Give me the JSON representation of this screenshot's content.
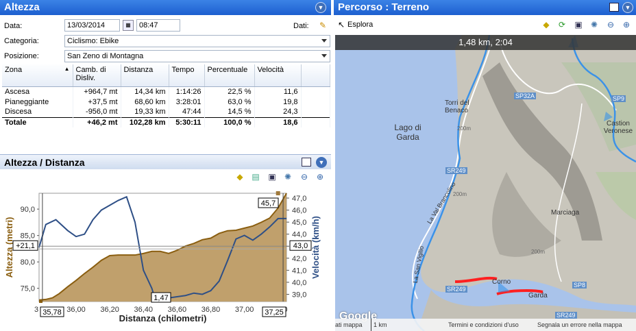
{
  "left_panel": {
    "title": "Altezza"
  },
  "form": {
    "date_label": "Data:",
    "date_value": "13/03/2014",
    "time_value": "08:47",
    "dati_label": "Dati:",
    "category_label": "Categoria:",
    "category_value": "Ciclismo: Ebike",
    "position_label": "Posizione:",
    "position_value": "San Zeno di Montagna"
  },
  "table": {
    "headers": [
      "Zona",
      "Camb. di Disliv.",
      "Distanza",
      "Tempo",
      "Percentuale",
      "Velocità"
    ],
    "rows": [
      [
        "Ascesa",
        "+964,7 mt",
        "14,34 km",
        "1:14:26",
        "22,5 %",
        "11,6"
      ],
      [
        "Pianeggiante",
        "+37,5 mt",
        "68,60 km",
        "3:28:01",
        "63,0 %",
        "19,8"
      ],
      [
        "Discesa",
        "-956,0 mt",
        "19,33 km",
        "47:44",
        "14,5 %",
        "24,3"
      ],
      [
        "Totale",
        "+46,2 mt",
        "102,28 km",
        "5:30:11",
        "100,0 %",
        "18,6"
      ]
    ]
  },
  "chart_section": {
    "title": "Altezza / Distanza"
  },
  "chart_data": {
    "type": "area",
    "xlabel": "Distanza (chilometri)",
    "ylabel": "Altezza (metri)",
    "y2label": "Velocità (km/h)",
    "xticks": [
      "3",
      "36,00",
      "36,20",
      "36,40",
      "36,60",
      "36,80",
      "37,00",
      "37,20"
    ],
    "yticks": [
      "75,0",
      "80,0",
      "85,0",
      "90,0"
    ],
    "y2ticks": [
      "39,0",
      "40,0",
      "41,0",
      "42,0",
      "43,0",
      "44,0",
      "45,0",
      "46,0",
      "47,0"
    ],
    "xlim": [
      35.78,
      37.25
    ],
    "ylim": [
      72.5,
      93
    ],
    "y2lim": [
      38.4,
      47.4
    ],
    "series": [
      {
        "name": "Altezza (metri)",
        "color": "#a07a3c",
        "x": [
          35.78,
          35.82,
          35.86,
          35.9,
          35.95,
          36.0,
          36.05,
          36.1,
          36.15,
          36.2,
          36.25,
          36.3,
          36.35,
          36.4,
          36.45,
          36.5,
          36.55,
          36.6,
          36.65,
          36.7,
          36.75,
          36.8,
          36.85,
          36.9,
          36.95,
          37.0,
          37.05,
          37.1,
          37.15,
          37.2,
          37.25
        ],
        "values": [
          72.8,
          72.9,
          73.2,
          74.0,
          75.3,
          76.5,
          77.8,
          79.0,
          80.3,
          81.2,
          81.3,
          81.3,
          81.3,
          81.6,
          82.0,
          82.0,
          81.6,
          82.2,
          83.0,
          83.5,
          84.2,
          84.5,
          85.4,
          85.9,
          86.0,
          86.4,
          86.8,
          87.5,
          88.3,
          90.2,
          93.0
        ]
      },
      {
        "name": "Velocità (km/h)",
        "color": "#2e4f86",
        "x": [
          35.78,
          35.82,
          35.88,
          35.95,
          36.0,
          36.05,
          36.1,
          36.15,
          36.25,
          36.3,
          36.35,
          36.4,
          36.45,
          36.47,
          36.5,
          36.55,
          36.6,
          36.65,
          36.7,
          36.75,
          36.8,
          36.85,
          36.9,
          36.95,
          37.0,
          37.05,
          37.1,
          37.15,
          37.2,
          37.25
        ],
        "values": [
          42.9,
          44.8,
          45.2,
          44.3,
          43.8,
          44.0,
          45.2,
          46.0,
          46.8,
          47.1,
          45.0,
          41.0,
          39.5,
          38.6,
          38.6,
          38.7,
          38.8,
          38.9,
          39.1,
          39.0,
          39.3,
          40.1,
          41.8,
          43.6,
          43.9,
          43.5,
          44.0,
          44.6,
          45.3,
          45.3
        ]
      }
    ],
    "labels": {
      "y_left_marker": "+21,1",
      "y_right_marker": "43,0",
      "max_marker": "45,7",
      "x_left_marker": "35,78",
      "x_right_marker": "37,25",
      "speed_min_marker": "1,47"
    }
  },
  "right_panel": {
    "title": "Percorso  : Terreno",
    "explore_label": "Esplora"
  },
  "map": {
    "top_readout": "1,48 km, 2:04",
    "labels": [
      "Torri del Benaco",
      "Lago di Garda",
      "Castion Veronese",
      "Marciaga",
      "Corno",
      "Garda",
      "SP32A",
      "SP9",
      "SP8",
      "SR249",
      "SR249",
      "SR249",
      "La Val Brancolino",
      "La San Vigilio",
      "200m",
      "200m",
      "200m"
    ],
    "footer": [
      "ati mappa",
      "1 km",
      "Termini e condizioni d'uso",
      "Segnala un errore nella mappa"
    ],
    "google": "Google"
  }
}
